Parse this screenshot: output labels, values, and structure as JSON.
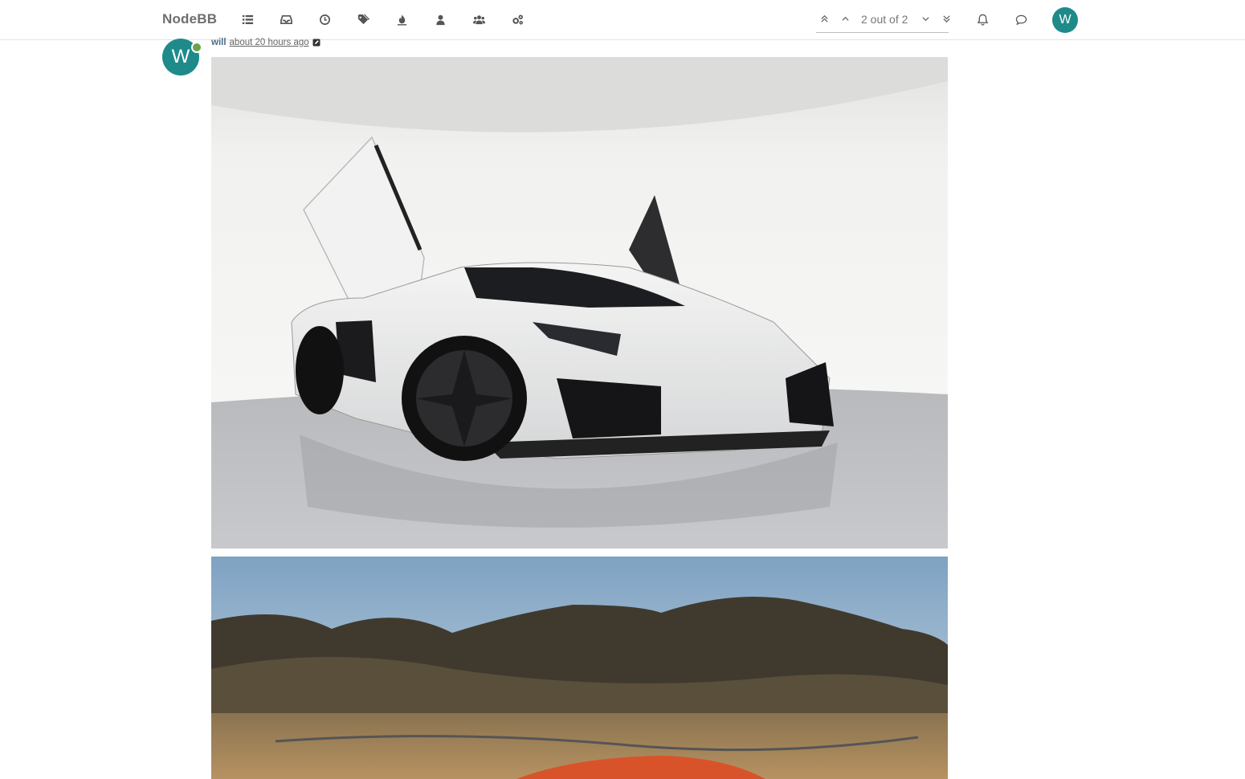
{
  "nav": {
    "brand": "NodeBB",
    "icons": [
      "categories-icon",
      "unread-icon",
      "recent-icon",
      "tags-icon",
      "popular-icon",
      "users-icon",
      "groups-icon",
      "admin-icon"
    ]
  },
  "pager": {
    "count": "2 out of 2"
  },
  "user": {
    "avatar_letter": "W",
    "avatar_color": "#1f8a8a"
  },
  "post": {
    "author": "will",
    "timestamp": "about 20 hours ago",
    "avatar_letter": "W",
    "online_color": "#6aa24a"
  },
  "images": [
    {
      "subject": "white sports car with scissor doors open in studio"
    },
    {
      "subject": "orange sports car in front of mountains"
    }
  ]
}
